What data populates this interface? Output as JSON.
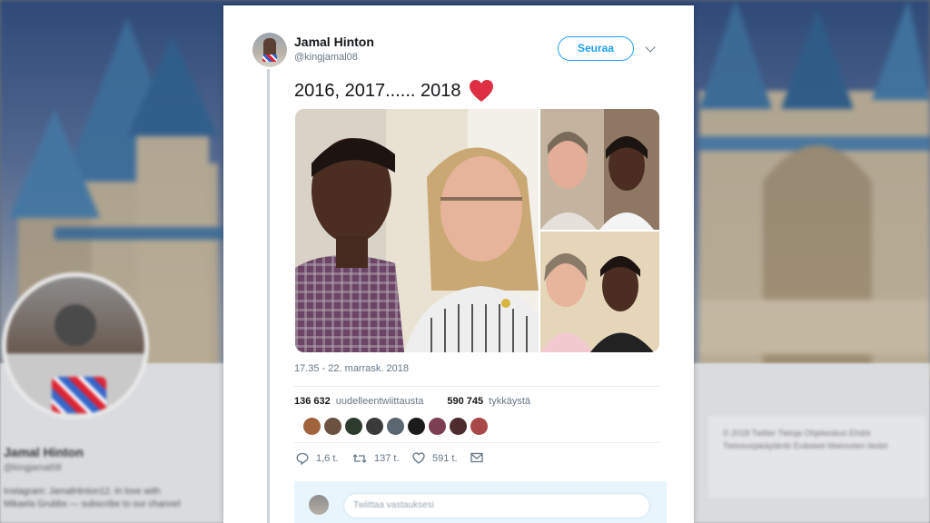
{
  "tweet": {
    "author_name": "Jamal Hinton",
    "author_handle": "@kingjamal08",
    "follow_label": "Seuraa",
    "text": "2016, 2017...... 2018",
    "emoji": "red-heart",
    "timestamp": "17.35 - 22. marrask. 2018",
    "retweets_count": "136 632",
    "retweets_label": "uudelleentwiittausta",
    "likes_count": "590 745",
    "likes_label": "tykkäystä",
    "reply_count": "1,6 t.",
    "retweet_count_short": "137 t.",
    "like_count_short": "591 t.",
    "reply_placeholder": "Twiittaa vastauksesi"
  },
  "background": {
    "profile_name": "Jamal Hinton",
    "profile_handle": "@kingjamal08",
    "bio_line1": "Instagram: JamalHinton12. In love with",
    "bio_line2": "Mikaela Grubbs — subscribe to our channel",
    "footer_line1": "© 2018 Twitter   Tietoja   Ohjekeskus   Ehdot",
    "footer_line2": "Tietosuojakäytäntö   Evästeet   Mainosten tiedot"
  },
  "colors": {
    "accent": "#1da1f2",
    "heart": "#e0245e",
    "text_primary": "#14171a",
    "text_secondary": "#657786"
  },
  "icons": [
    "reply-icon",
    "retweet-icon",
    "like-icon",
    "message-icon",
    "chevron-down-icon"
  ]
}
